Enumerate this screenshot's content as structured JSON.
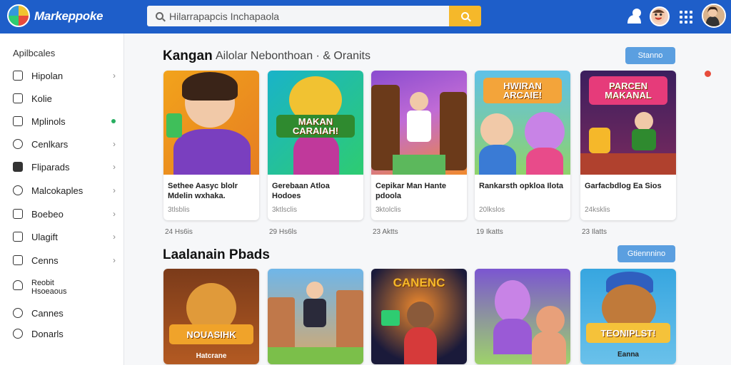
{
  "app": {
    "title": "Markeppoke"
  },
  "search": {
    "placeholder": "Hilarrapapcis Inchapaola"
  },
  "sidebar": {
    "header": "Apilbcales",
    "items": [
      {
        "label": "Hipolan",
        "icon": "square-icon",
        "trail": "chevron"
      },
      {
        "label": "Kolie",
        "icon": "folder-icon",
        "trail": "none"
      },
      {
        "label": "Mplinols",
        "icon": "document-icon",
        "trail": "dot"
      },
      {
        "label": "Cenlkars",
        "icon": "gamepad-icon",
        "trail": "chevron"
      },
      {
        "label": "Fliparads",
        "icon": "bag-icon",
        "trail": "chevron"
      },
      {
        "label": "Malcokaples",
        "icon": "search-icon",
        "trail": "chevron"
      },
      {
        "label": "Boebeo",
        "icon": "puzzle-icon",
        "trail": "chevron"
      },
      {
        "label": "Ulagift",
        "icon": "gift-icon",
        "trail": "chevron"
      },
      {
        "label": "Cenns",
        "icon": "grid-icon",
        "trail": "chevron"
      },
      {
        "label": "Reobit",
        "sublabel": "Hsoeaous",
        "icon": "bell-icon",
        "trail": "none"
      },
      {
        "label": "Cannes",
        "icon": "clock-icon",
        "trail": "none"
      },
      {
        "label": "Donarls",
        "icon": "settings-icon",
        "trail": "none"
      }
    ]
  },
  "section1": {
    "title": "Kangan",
    "subtitle": "Ailolar Nebonthoan · & Oranits",
    "button": "Stanno",
    "cards": [
      {
        "title": "Sethee Aasyc blolr Mdelin wxhaka.",
        "meta": "3tlsblis",
        "below": "24 Hs6is",
        "colors": [
          "#f2a31b",
          "#7a3fbf"
        ],
        "banner": ""
      },
      {
        "title": "Gerebaan Atloa Hodoes",
        "meta": "3ktlsclis",
        "below": "29 Hs6ls",
        "colors": [
          "#19b3c9",
          "#f1c232"
        ],
        "banner": "MAKAN CARAIAH!"
      },
      {
        "title": "Cepikar Man Hante pdoola",
        "meta": "3ktolclis",
        "below": "23 Aktts",
        "colors": [
          "#8a4ccf",
          "#f08a2d"
        ],
        "banner": ""
      },
      {
        "title": "Rankarsth opkloa Ilota",
        "meta": "20lkslos",
        "below": "19 Ikatts",
        "colors": [
          "#5fc1e8",
          "#f3a43a"
        ],
        "banner": "HWIRAN ARCAIE!"
      },
      {
        "title": "Garfacbdlog Ea Sios",
        "meta": "24ksklis",
        "below": "23 Ilatts",
        "colors": [
          "#3b1f5e",
          "#e63b7a"
        ],
        "banner": "PARCEN MAKANAL"
      }
    ]
  },
  "section2": {
    "title": "Laalanain Pbads",
    "button": "Gtiennnino",
    "cards": [
      {
        "colors": [
          "#7b3b1a",
          "#f0a32a"
        ],
        "banner": "NOUASIHK",
        "caption": "Hatcrane"
      },
      {
        "colors": [
          "#6fb6e9",
          "#7bbf4a"
        ],
        "banner": "",
        "caption": ""
      },
      {
        "colors": [
          "#1a1a3a",
          "#f08a2d"
        ],
        "banner": "CANENC",
        "caption": ""
      },
      {
        "colors": [
          "#7b56d1",
          "#9ed36a"
        ],
        "banner": "",
        "caption": ""
      },
      {
        "colors": [
          "#37a6e0",
          "#f5c23a"
        ],
        "banner": "TEONIPLST!",
        "caption": "Eanna"
      }
    ]
  }
}
